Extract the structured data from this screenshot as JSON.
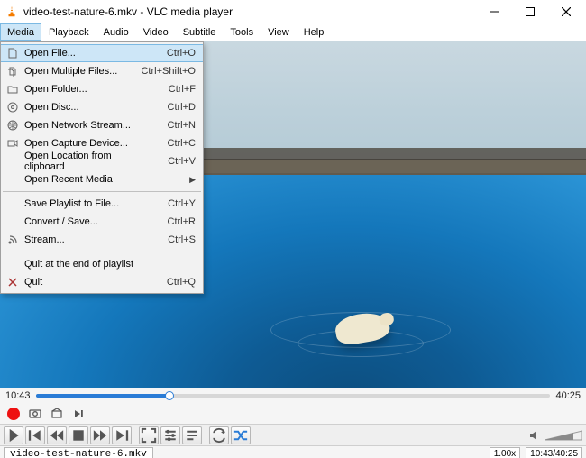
{
  "title": "video-test-nature-6.mkv - VLC media player",
  "menubar": [
    "Media",
    "Playback",
    "Audio",
    "Video",
    "Subtitle",
    "Tools",
    "View",
    "Help"
  ],
  "media_menu": [
    {
      "type": "item",
      "icon": "file",
      "label": "Open File...",
      "shortcut": "Ctrl+O",
      "highlight": true
    },
    {
      "type": "item",
      "icon": "files",
      "label": "Open Multiple Files...",
      "shortcut": "Ctrl+Shift+O"
    },
    {
      "type": "item",
      "icon": "folder",
      "label": "Open Folder...",
      "shortcut": "Ctrl+F"
    },
    {
      "type": "item",
      "icon": "disc",
      "label": "Open Disc...",
      "shortcut": "Ctrl+D"
    },
    {
      "type": "item",
      "icon": "network",
      "label": "Open Network Stream...",
      "shortcut": "Ctrl+N"
    },
    {
      "type": "item",
      "icon": "capture",
      "label": "Open Capture Device...",
      "shortcut": "Ctrl+C"
    },
    {
      "type": "item",
      "icon": "",
      "label": "Open Location from clipboard",
      "shortcut": "Ctrl+V"
    },
    {
      "type": "item",
      "icon": "",
      "label": "Open Recent Media",
      "shortcut": "",
      "submenu": true
    },
    {
      "type": "sep"
    },
    {
      "type": "item",
      "icon": "",
      "label": "Save Playlist to File...",
      "shortcut": "Ctrl+Y"
    },
    {
      "type": "item",
      "icon": "",
      "label": "Convert / Save...",
      "shortcut": "Ctrl+R"
    },
    {
      "type": "item",
      "icon": "stream",
      "label": "Stream...",
      "shortcut": "Ctrl+S"
    },
    {
      "type": "sep"
    },
    {
      "type": "item",
      "icon": "",
      "label": "Quit at the end of playlist",
      "shortcut": ""
    },
    {
      "type": "item",
      "icon": "quit",
      "label": "Quit",
      "shortcut": "Ctrl+Q"
    }
  ],
  "seek": {
    "current": "10:43",
    "total": "40:25",
    "progress_pct": 26
  },
  "status": {
    "filename": "video-test-nature-6.mkv",
    "speed": "1.00x",
    "time": "10:43/40:25"
  }
}
